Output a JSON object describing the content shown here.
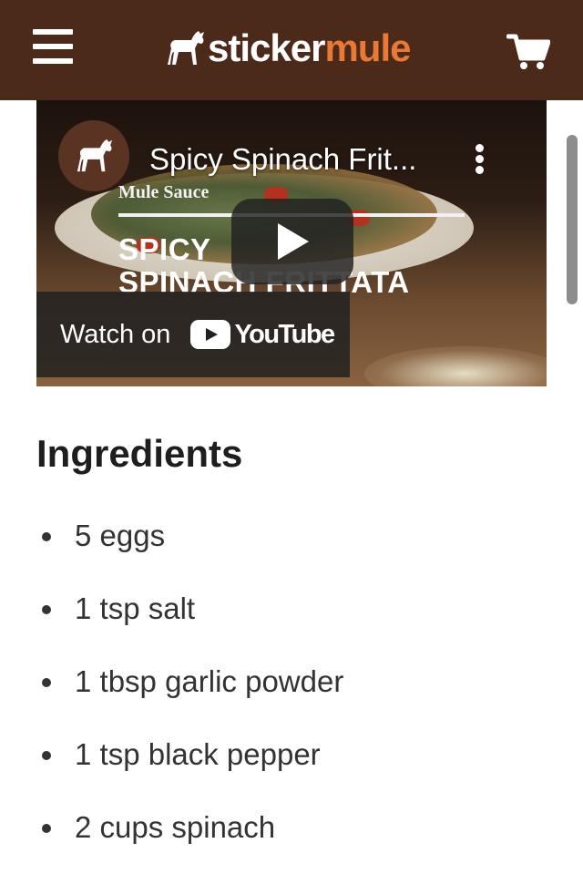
{
  "header": {
    "logo_part1": "sticker",
    "logo_part2": "mule",
    "menu_icon": "hamburger-menu-icon",
    "cart_icon": "shopping-cart-icon",
    "colors": {
      "background": "#4b2a1a",
      "logo_accent": "#e87a35"
    }
  },
  "video": {
    "title": "Spicy Spinach Frit...",
    "overlay_brand": "Mule Sauce",
    "overlay_title_line1": "SPICY",
    "overlay_title_line2": "SPINACH FRITTATA",
    "watch_label": "Watch on",
    "youtube_label": "YouTube"
  },
  "ingredients": {
    "heading": "Ingredients",
    "items": [
      "5 eggs",
      "1 tsp salt",
      "1 tbsp garlic powder",
      "1 tsp black pepper",
      "2 cups spinach"
    ]
  }
}
